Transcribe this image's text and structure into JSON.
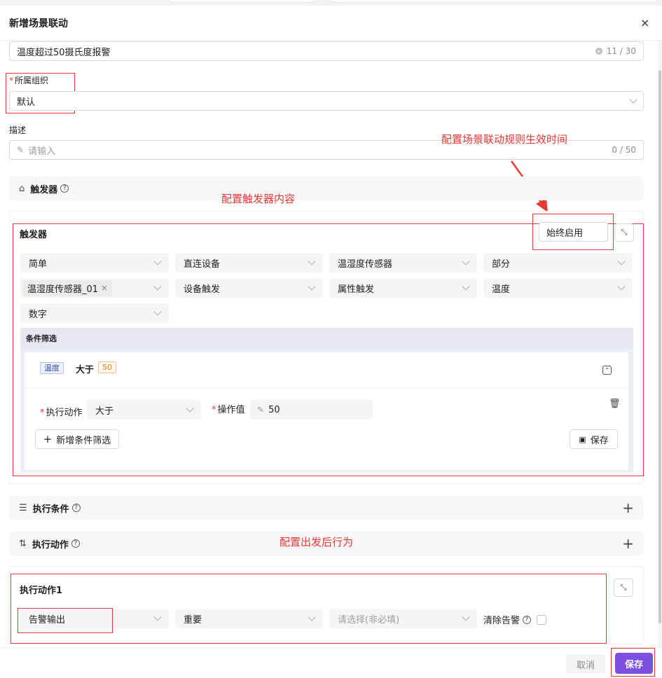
{
  "dialog": {
    "title": "新增场景联动",
    "close": "×"
  },
  "name_field": {
    "value": "温度超过50摄氏度报警",
    "count": "11 / 30"
  },
  "org": {
    "label": "所属组织",
    "value": "默认"
  },
  "desc": {
    "label": "描述",
    "placeholder": "请输入",
    "count": "0 / 50"
  },
  "sections": {
    "trigger": "触发器",
    "conditions": "执行条件",
    "actions": "执行动作"
  },
  "annotations": {
    "effective_time": "配置场景联动规则生效时间",
    "trigger_content": "配置触发器内容",
    "after_trigger": "配置出发后行为"
  },
  "trigger": {
    "title": "触发器",
    "enable": "始终启用",
    "row1": [
      "简单",
      "直连设备",
      "温湿度传感器",
      "部分"
    ],
    "device_tag": "温湿度传感器_01",
    "row2": [
      "设备触发",
      "属性触发",
      "温度"
    ],
    "row3": [
      "数字"
    ],
    "filter": {
      "title": "条件筛选",
      "prop_tag": "温度",
      "op_text": "大于",
      "value_tag": "50",
      "action_label": "执行动作",
      "action_value": "大于",
      "operand_label": "操作值",
      "operand_value": "50",
      "add_button": "新增条件筛选",
      "save_button": "保存"
    }
  },
  "action": {
    "title": "执行动作1",
    "selects": [
      "告警输出",
      "重要"
    ],
    "optional_placeholder": "请选择(非必填)",
    "clear_alarm": "清除告警"
  },
  "footer": {
    "cancel": "取消",
    "save": "保存"
  },
  "colors": {
    "primary": "#7b4fe0",
    "annotation": "#e53935"
  }
}
